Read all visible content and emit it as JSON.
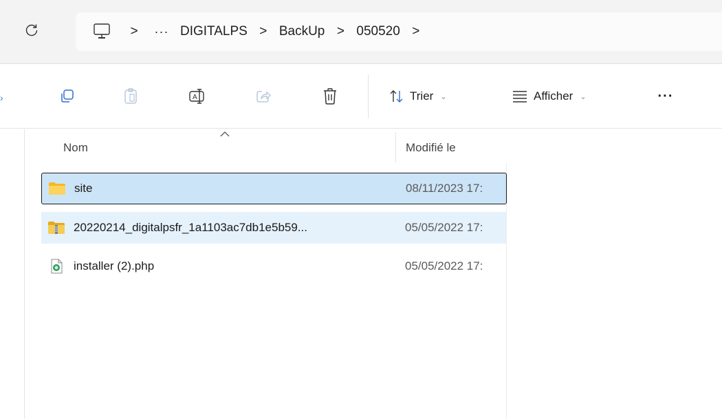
{
  "address_bar": {
    "breadcrumbs": [
      {
        "label": "DIGITALPS"
      },
      {
        "label": "BackUp"
      },
      {
        "label": "050520"
      }
    ],
    "ellipsis": "···",
    "separator": ">",
    "icons": {
      "refresh": "refresh-icon",
      "pc": "this-pc-icon"
    }
  },
  "command_bar": {
    "buttons": [
      {
        "name": "copy-button",
        "icon": "copy-icon"
      },
      {
        "name": "paste-button",
        "icon": "paste-icon"
      },
      {
        "name": "rename-button",
        "icon": "rename-icon"
      },
      {
        "name": "share-button",
        "icon": "share-icon"
      },
      {
        "name": "delete-button",
        "icon": "trash-icon"
      }
    ],
    "sort": {
      "label": "Trier",
      "icon": "sort-icon"
    },
    "view": {
      "label": "Afficher",
      "icon": "view-icon"
    },
    "more": "···"
  },
  "file_list": {
    "columns": {
      "name": "Nom",
      "modified": "Modifié le"
    },
    "sort_indicator": "ascending",
    "rows": [
      {
        "name": "site",
        "modified": "08/11/2023 17:",
        "type": "folder",
        "state": "selected"
      },
      {
        "name": "20220214_digitalpsfr_1a1103ac7db1e5b59...",
        "modified": "05/05/2022 17:",
        "type": "zip",
        "state": "hovered"
      },
      {
        "name": "installer (2).php",
        "modified": "05/05/2022 17:",
        "type": "php",
        "state": "normal"
      }
    ]
  },
  "colors": {
    "address_bg": "#f3f3f3",
    "selected_row": "#cce4f7",
    "hover_row": "#e5f1fb",
    "folder": "#f7c948",
    "accent": "#3b7bd4"
  }
}
